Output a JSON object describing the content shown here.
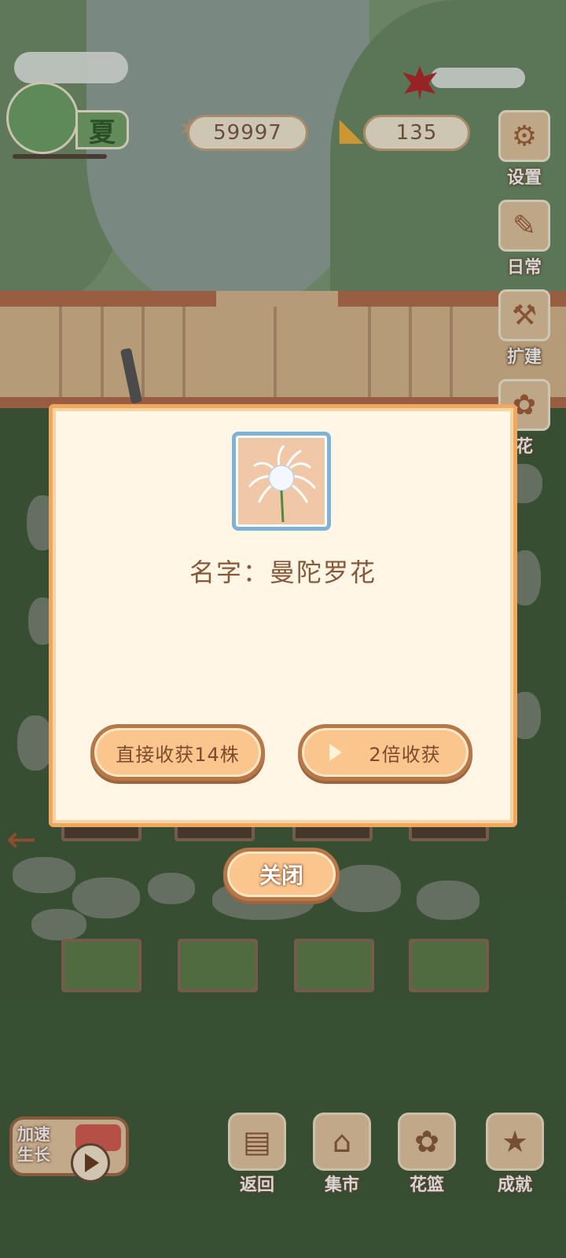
{
  "hud": {
    "season_label": "夏",
    "fish_count": "59997",
    "cheese_count": "135"
  },
  "side_menu": [
    {
      "label": "设置",
      "icon": "gear-icon"
    },
    {
      "label": "日常",
      "icon": "task-list-icon"
    },
    {
      "label": "扩建",
      "icon": "hammer-icon"
    },
    {
      "label": "花",
      "icon": "flower-icon"
    }
  ],
  "dialog": {
    "flower_icon": "white-spider-lily-icon",
    "name_label": "名字：",
    "name_value": "曼陀罗花",
    "harvest_button": "直接收获14株",
    "double_button": "2倍收获",
    "close_button": "关闭"
  },
  "speed_up": {
    "label": "加速生长",
    "line1": "加速",
    "line2": "生长"
  },
  "bottom_nav": [
    {
      "label": "返回",
      "icon": "window-icon"
    },
    {
      "label": "集市",
      "icon": "market-stall-icon"
    },
    {
      "label": "花篮",
      "icon": "flower-basket-icon"
    },
    {
      "label": "成就",
      "icon": "trophy-icon"
    }
  ],
  "colors": {
    "dialog_bg": "#fff6e6",
    "dialog_border": "#f0a860",
    "button_fill": "#fbc58e",
    "button_border": "#b67749",
    "ground": "#3f5a39"
  }
}
